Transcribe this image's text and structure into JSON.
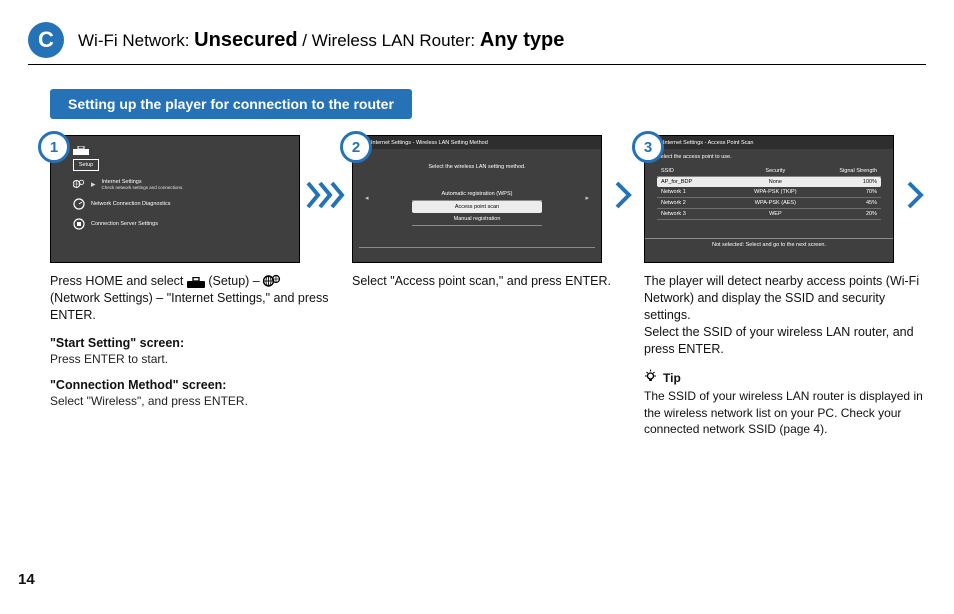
{
  "pageNumber": "14",
  "header": {
    "letter": "C",
    "line_prefix": "Wi-Fi Network: ",
    "line_bold1": "Unsecured",
    "line_mid": " / Wireless LAN Router: ",
    "line_bold2": "Any type"
  },
  "sectionPill": "Setting up the player for connection to the router",
  "step1": {
    "badge": "1",
    "screen": {
      "setupLabel": "Setup",
      "row1_title": "Internet Settings",
      "row1_sub": "Check network settings and connections.",
      "row2_title": "Network Connection Diagnostics",
      "row3_title": "Connection Server Settings"
    },
    "copy": "Press HOME and select        (Setup) – \n(Network Settings) – \"Internet Settings,\" and press ENTER.",
    "sub1_title": "\"Start Setting\" screen:",
    "sub1_body": "Press ENTER to start.",
    "sub2_title": "\"Connection Method\" screen:",
    "sub2_body": "Select \"Wireless\", and press ENTER."
  },
  "step2": {
    "badge": "2",
    "screen": {
      "titlebar": "Internet Settings - Wireless LAN Setting Method",
      "prompt": "Select the wireless LAN setting method.",
      "opt1": "Automatic registration (WPS)",
      "opt2": "Access point scan",
      "opt3": "Manual registration"
    },
    "copy": "Select \"Access point scan,\" and press ENTER."
  },
  "step3": {
    "badge": "3",
    "screen": {
      "titlebar": "Internet Settings - Access Point Scan",
      "prompt": "Select the access point to use.",
      "head_ssid": "SSID",
      "head_sec": "Security",
      "head_sig": "Signal Strength",
      "rows": [
        {
          "ssid": "AP_for_BDP",
          "sec": "None",
          "sig": "100%"
        },
        {
          "ssid": "Network 1",
          "sec": "WPA-PSK (TKIP)",
          "sig": "70%"
        },
        {
          "ssid": "Network 2",
          "sec": "WPA-PSK (AES)",
          "sig": "45%"
        },
        {
          "ssid": "Network 3",
          "sec": "WEP",
          "sig": "20%"
        }
      ],
      "footer": "Not selected: Select and go to the next screen."
    },
    "copy": "The player will detect nearby access points (Wi-Fi Network) and display the SSID and security settings.\nSelect the SSID of your wireless LAN router, and press ENTER.",
    "tip_label": "Tip",
    "tip_body": "The SSID of your wireless LAN router is displayed in the wireless network list on your PC. Check your connected network SSID (page 4)."
  }
}
